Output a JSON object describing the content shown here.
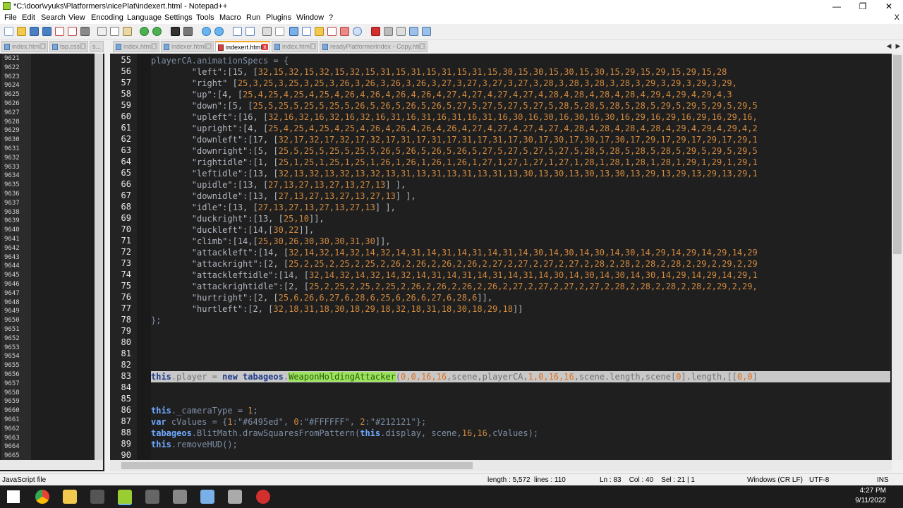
{
  "window": {
    "title": "*C:\\door\\vyuks\\Platformers\\nicePlat\\indexert.html - Notepad++",
    "minimize": "—",
    "maximize": "❐",
    "close": "✕"
  },
  "menu": [
    "File",
    "Edit",
    "Search",
    "View",
    "Encoding",
    "Language",
    "Settings",
    "Tools",
    "Macro",
    "Run",
    "Plugins",
    "Window",
    "?"
  ],
  "menu_close": "X",
  "left_tabs": [
    "index.html",
    "tsp.css",
    "s..."
  ],
  "tabs": [
    "index.html",
    "indexer.html",
    "indexert.html",
    "index.html",
    "readyPlatformerIndex - Copy.html"
  ],
  "active_tab": "indexert.html",
  "left_pane_lines": [
    "9621",
    "9622",
    "9623",
    "9624",
    "9625",
    "9626",
    "9627",
    "9628",
    "9629",
    "9630",
    "9631",
    "9632",
    "9633",
    "9634",
    "9635",
    "9636",
    "9637",
    "9638",
    "9639",
    "9640",
    "9641",
    "9642",
    "9643",
    "9644",
    "9645",
    "9646",
    "9647",
    "9648",
    "9649",
    "9650",
    "9651",
    "9652",
    "9653",
    "9654",
    "9655",
    "9656",
    "9657",
    "9658",
    "9659",
    "9660",
    "9661",
    "9662",
    "9663",
    "9664",
    "9665"
  ],
  "editor": {
    "line_numbers": [
      "55",
      "56",
      "57",
      "58",
      "59",
      "60",
      "61",
      "62",
      "63",
      "64",
      "65",
      "66",
      "67",
      "68",
      "69",
      "70",
      "71",
      "72",
      "73",
      "74",
      "75",
      "76",
      "77",
      "78",
      "79",
      "80",
      "81",
      "82",
      "83",
      "84",
      "85",
      "86",
      "87",
      "88",
      "89",
      "90"
    ],
    "lines": [
      [
        [
          "def",
          "playerCA.animationSpecs = {"
        ]
      ],
      [
        [
          "str",
          "        \"left\":[15, ["
        ],
        [
          "num",
          "32,15,32,15,32,15,32,15,31,15,31,15,31,15,31,15,30,15,30,15,30,15,30,15,29,15,29,15,29,15,28"
        ]
      ],
      [
        [
          "str",
          "        \"right\" ["
        ],
        [
          "num",
          "25,3,25,3,25,3,25,3,26,3,26,3,26,3,26,3,27,3,27,3,27,3,27,3,28,3,28,3,28,3,28,3,29,3,29,3,29,3,29,"
        ]
      ],
      [
        [
          "str",
          "        \"up\":[4, ["
        ],
        [
          "num",
          "25,4,25,4,25,4,25,4,26,4,26,4,26,4,26,4,27,4,27,4,27,4,27,4,28,4,28,4,28,4,28,4,29,4,29,4,29,4,3"
        ]
      ],
      [
        [
          "str",
          "        \"down\":[5, ["
        ],
        [
          "num",
          "25,5,25,5,25,5,25,5,26,5,26,5,26,5,26,5,27,5,27,5,27,5,27,5,28,5,28,5,28,5,28,5,29,5,29,5,29,5,29,5"
        ]
      ],
      [
        [
          "str",
          "        \"upleft\":[16, ["
        ],
        [
          "num",
          "32,16,32,16,32,16,32,16,31,16,31,16,31,16,31,16,30,16,30,16,30,16,30,16,29,16,29,16,29,16,29,16,"
        ]
      ],
      [
        [
          "str",
          "        \"upright\":[4, ["
        ],
        [
          "num",
          "25,4,25,4,25,4,25,4,26,4,26,4,26,4,26,4,27,4,27,4,27,4,27,4,28,4,28,4,28,4,28,4,29,4,29,4,29,4,2"
        ]
      ],
      [
        [
          "str",
          "        \"downleft\":[17, ["
        ],
        [
          "num",
          "32,17,32,17,32,17,32,17,31,17,31,17,31,17,31,17,30,17,30,17,30,17,30,17,29,17,29,17,29,17,29,1"
        ]
      ],
      [
        [
          "str",
          "        \"downright\":[5, ["
        ],
        [
          "num",
          "25,5,25,5,25,5,25,5,26,5,26,5,26,5,26,5,27,5,27,5,27,5,27,5,28,5,28,5,28,5,28,5,29,5,29,5,29,5"
        ]
      ],
      [
        [
          "str",
          "        \"rightidle\":[1, ["
        ],
        [
          "num",
          "25,1,25,1,25,1,25,1,26,1,26,1,26,1,26,1,27,1,27,1,27,1,27,1,28,1,28,1,28,1,28,1,29,1,29,1,29,1"
        ]
      ],
      [
        [
          "str",
          "        \"leftidle\":[13, ["
        ],
        [
          "num",
          "32,13,32,13,32,13,32,13,31,13,31,13,31,13,31,13,30,13,30,13,30,13,30,13,29,13,29,13,29,13,29,1"
        ]
      ],
      [
        [
          "str",
          "        \"upidle\":[13, ["
        ],
        [
          "num",
          "27,13,27,13,27,13,27,13"
        ],
        [
          "str",
          "] ],"
        ]
      ],
      [
        [
          "str",
          "        \"downidle\":[13, ["
        ],
        [
          "num",
          "27,13,27,13,27,13,27,13"
        ],
        [
          "str",
          "] ],"
        ]
      ],
      [
        [
          "str",
          "        \"idle\":[13, ["
        ],
        [
          "num",
          "27,13,27,13,27,13,27,13"
        ],
        [
          "str",
          "] ],"
        ]
      ],
      [
        [
          "str",
          "        \"duckright\":[13, ["
        ],
        [
          "num",
          "25,10"
        ],
        [
          "str",
          "]],"
        ]
      ],
      [
        [
          "str",
          "        \"duckleft\":[14,["
        ],
        [
          "num",
          "30,22"
        ],
        [
          "str",
          "]],"
        ]
      ],
      [
        [
          "str",
          "        \"climb\":[14,["
        ],
        [
          "num",
          "25,30,26,30,30,30,31,30"
        ],
        [
          "str",
          "]],"
        ]
      ],
      [
        [
          "str",
          "        \"attackleft\":[14, ["
        ],
        [
          "num",
          "32,14,32,14,32,14,32,14,31,14,31,14,31,14,31,14,30,14,30,14,30,14,30,14,29,14,29,14,29,14,29"
        ]
      ],
      [
        [
          "str",
          "        \"attackright\":[2, ["
        ],
        [
          "num",
          "25,2,25,2,25,2,25,2,26,2,26,2,26,2,26,2,27,2,27,2,27,2,27,2,28,2,28,2,28,2,28,2,29,2,29,2,29"
        ]
      ],
      [
        [
          "str",
          "        \"attackleftidle\":[14, ["
        ],
        [
          "num",
          "32,14,32,14,32,14,32,14,31,14,31,14,31,14,31,14,30,14,30,14,30,14,30,14,29,14,29,14,29,1"
        ]
      ],
      [
        [
          "str",
          "        \"attackrightidle\":[2, ["
        ],
        [
          "num",
          "25,2,25,2,25,2,25,2,26,2,26,2,26,2,26,2,27,2,27,2,27,2,27,2,28,2,28,2,28,2,28,2,29,2,29,"
        ]
      ],
      [
        [
          "str",
          "        \"hurtright\":[2, ["
        ],
        [
          "num",
          "25,6,26,6,27,6,28,6,25,6,26,6,27,6,28,6"
        ],
        [
          "str",
          "]],"
        ]
      ],
      [
        [
          "str",
          "        \"hurtleft\":[2, ["
        ],
        [
          "num",
          "32,18,31,18,30,18,29,18,32,18,31,18,30,18,29,18"
        ],
        [
          "str",
          "]]"
        ]
      ],
      [
        [
          "def",
          "};"
        ]
      ],
      [],
      [],
      [],
      [],
      [
        [
          "curkw",
          "this"
        ],
        [
          "curpl",
          ".player = "
        ],
        [
          "curkw",
          "new tabageos"
        ],
        [
          "curpl",
          "."
        ],
        [
          "hl",
          "WeaponHoldingAttacker"
        ],
        [
          "curpl",
          "("
        ],
        [
          "curnum",
          "0,0,16,16"
        ],
        [
          "curpl",
          ",scene,playerCA,"
        ],
        [
          "curnum",
          "1,0,16,16"
        ],
        [
          "curpl",
          ",scene.length,scene["
        ],
        [
          "curnum",
          "0"
        ],
        [
          "curpl",
          "].length,[["
        ],
        [
          "curnum",
          "0,0"
        ],
        [
          "curpl",
          "]"
        ]
      ],
      [],
      [],
      [
        [
          "kw",
          "this"
        ],
        [
          "def",
          "._cameraType = "
        ],
        [
          "num",
          "1"
        ],
        [
          "def",
          ";"
        ]
      ],
      [
        [
          "kw",
          "var"
        ],
        [
          "def",
          " cValues = {"
        ],
        [
          "num",
          "1"
        ],
        [
          "def",
          ":\"#6495ed\", "
        ],
        [
          "num",
          "0"
        ],
        [
          "def",
          ":\"#FFFFFF\", "
        ],
        [
          "num",
          "2"
        ],
        [
          "def",
          ":\"#212121\"};"
        ]
      ],
      [
        [
          "kw",
          "tabageos"
        ],
        [
          "def",
          ".BlitMath.drawSquaresFromPattern("
        ],
        [
          "kw",
          "this"
        ],
        [
          "def",
          ".display, scene,"
        ],
        [
          "num",
          "16,16"
        ],
        [
          "def",
          ",cValues);"
        ]
      ],
      [
        [
          "kw",
          "this"
        ],
        [
          "def",
          ".removeHUD();"
        ]
      ],
      []
    ]
  },
  "status": {
    "file_type": "JavaScript file",
    "length": "length : 5,572",
    "lines": "lines : 110",
    "position": "Ln : 83    Col : 40    Sel : 21 | 1",
    "eol": "Windows (CR LF)",
    "encoding": "UTF-8",
    "mode": "INS"
  },
  "clock": {
    "time": "4:27 PM",
    "date": "9/11/2022"
  }
}
